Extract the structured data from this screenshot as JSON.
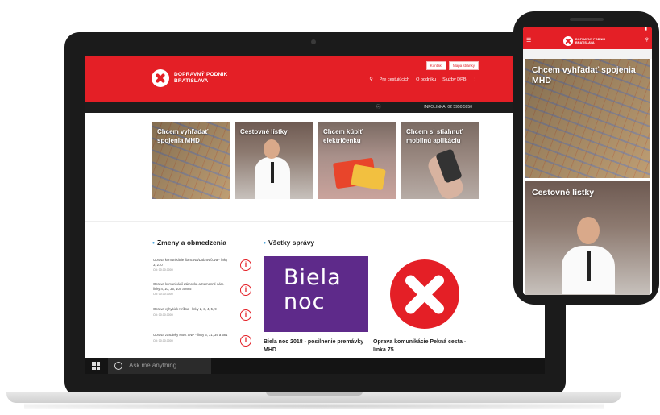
{
  "header": {
    "logo_line1": "DOPRAVNÝ PODNIK",
    "logo_line2": "BRATISLAVA",
    "top_buttons": [
      "Kontakt",
      "Mapa stránky"
    ],
    "nav": [
      "Pre cestujúcich",
      "O podniku",
      "Služby DPB"
    ],
    "infoline": "INFOLINKA: 02 5950 5950"
  },
  "tiles": [
    {
      "label": "Chcem vyhľadať spojenia MHD"
    },
    {
      "label": "Cestovné lístky"
    },
    {
      "label": "Chcem kúpiť električenku"
    },
    {
      "label": "Chcem si stiahnuť mobilnú aplikáciu"
    }
  ],
  "changes": {
    "title": "Zmeny a obmedzenia",
    "items": [
      {
        "text": "Oprava komunikácie Šancová/Dobrovičova - linky 3, 210",
        "date": "Od: 00.00.0000"
      },
      {
        "text": "Oprava komunikácií Zámocká a Kamenné nám. - linky 4, 10, 35, 100 a N95",
        "date": "Od: 00.00.0000"
      },
      {
        "text": "Oprava výhybiek Krížna - linky 2, 3, 4, 5, 9",
        "date": "Od: 00.00.0000"
      },
      {
        "text": "Oprava zastávky Most SNP - linky 3, 31, 39 a 581",
        "date": "Od: 00.00.0000"
      }
    ]
  },
  "news": {
    "title": "Všetky správy",
    "biela_text_line1": "Biela",
    "biela_text_line2": "noc",
    "cards": [
      {
        "title": "Biela noc 2018 - posilnenie premávky MHD"
      },
      {
        "title": "Oprava komunikácie Pekná cesta - linka 75"
      }
    ]
  },
  "taskbar": {
    "search_placeholder": "Ask me anything"
  },
  "phone": {
    "logo_line1": "DOPRAVNÝ PODNIK",
    "logo_line2": "BRATISLAVA",
    "tiles": [
      {
        "label": "Chcem vyhľadať spojenia MHD"
      },
      {
        "label": "Cestovné lístky"
      }
    ]
  },
  "colors": {
    "brand_red": "#e41f26",
    "accent_blue": "#2a93d5",
    "biela_purple": "#5e2a8a"
  }
}
